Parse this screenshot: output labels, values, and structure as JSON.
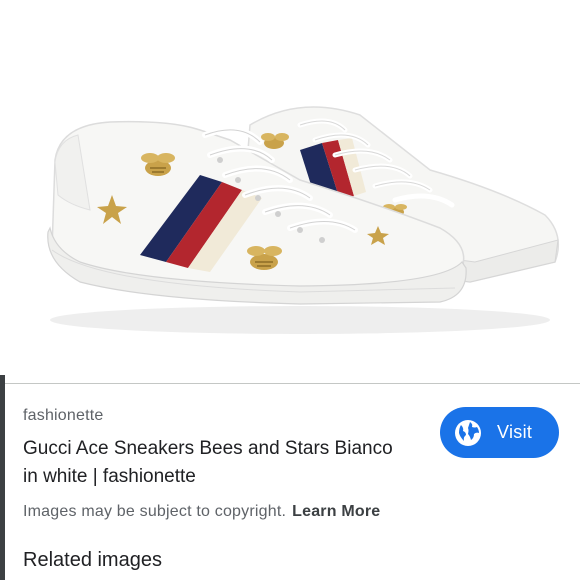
{
  "result": {
    "source": "fashionette",
    "title_line1": "Gucci Ace Sneakers Bees and Stars Bianco",
    "title_line2": "in white | fashionette",
    "visit_label": "Visit",
    "copyright_text": "Images may be subject to copyright.",
    "learn_more_label": "Learn More",
    "related_heading": "Related images"
  },
  "colors": {
    "accent": "#1a73e8",
    "stripe_navy": "#1f2a5c",
    "stripe_red": "#b3262e",
    "stripe_cream": "#f1ead8",
    "embroidery_gold": "#c9a24a"
  },
  "icons": {
    "visit": "globe-icon"
  }
}
